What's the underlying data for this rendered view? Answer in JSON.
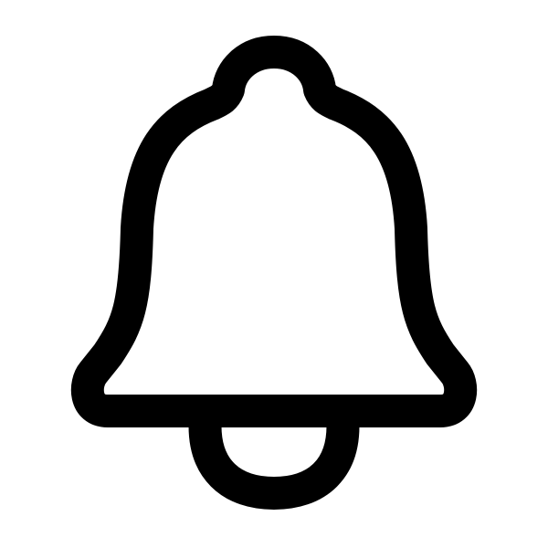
{
  "icon": {
    "name": "bell-icon",
    "stroke_color": "#000000",
    "fill_color": "#ffffff",
    "background": "#ffffff"
  }
}
